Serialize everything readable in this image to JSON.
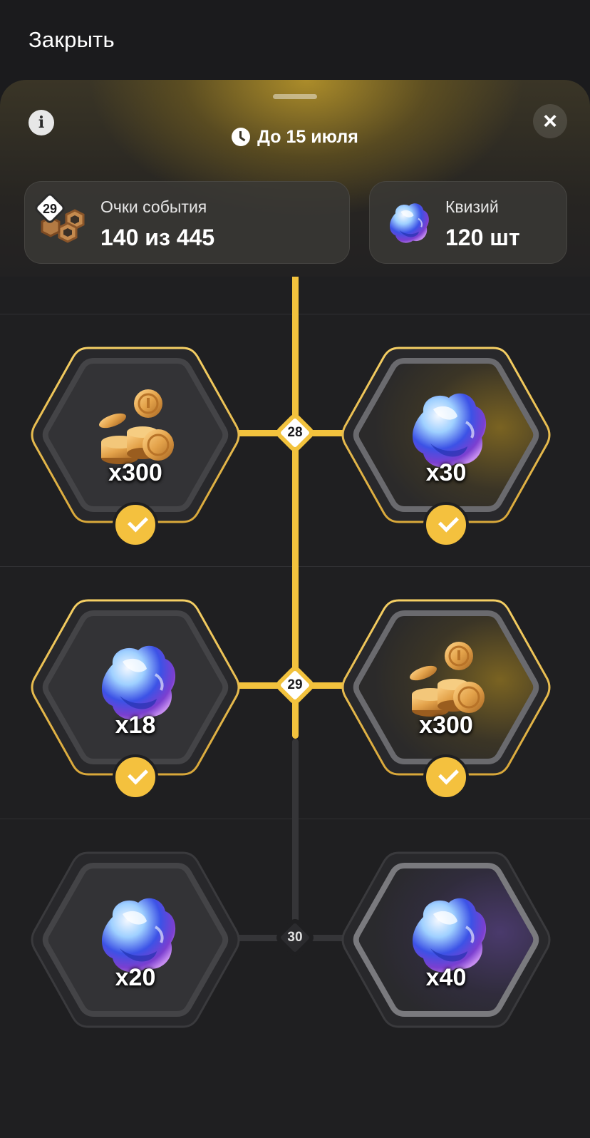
{
  "top_bar": {
    "close_label": "Закрыть"
  },
  "header": {
    "deadline": "До 15 июля",
    "points_card": {
      "badge": "29",
      "title": "Очки события",
      "value": "140 из 445"
    },
    "quiz_card": {
      "title": "Квизий",
      "value": "120 шт"
    }
  },
  "levels": [
    {
      "level": "28",
      "left": {
        "item": "coins-icon",
        "qty": "x300",
        "claimed": true
      },
      "right": {
        "item": "crystal-icon",
        "qty": "x30",
        "claimed": true
      }
    },
    {
      "level": "29",
      "left": {
        "item": "crystal-icon",
        "qty": "x18",
        "claimed": true
      },
      "right": {
        "item": "coins-icon",
        "qty": "x300",
        "claimed": true
      }
    },
    {
      "level": "30",
      "left": {
        "item": "crystal-icon",
        "qty": "x20",
        "claimed": false
      },
      "right": {
        "item": "crystal-icon",
        "qty": "x40",
        "claimed": false
      }
    }
  ],
  "colors": {
    "accent": "#f2c23d",
    "background": "#1b1b1d",
    "locked_line": "#353538"
  }
}
